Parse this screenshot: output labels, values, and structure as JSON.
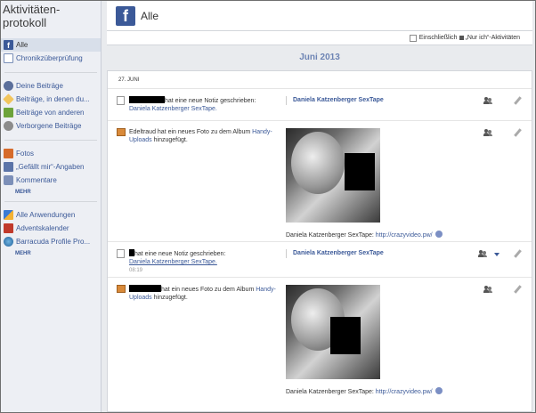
{
  "sidebar": {
    "title": "Aktivitäten-protokoll",
    "group1": [
      {
        "label": "Alle",
        "icon": "facebook-icon",
        "active": true
      },
      {
        "label": "Chronikzüberprüfung",
        "icon": "review-icon"
      }
    ],
    "group2": [
      {
        "label": "Deine Beiträge",
        "icon": "person-icon"
      },
      {
        "label": "Beiträge, in denen du...",
        "icon": "tag-icon"
      },
      {
        "label": "Beiträge von anderen",
        "icon": "post-icon"
      },
      {
        "label": "Verborgene Beiträge",
        "icon": "hidden-icon"
      }
    ],
    "group3": [
      {
        "label": "Fotos",
        "icon": "photos-icon"
      },
      {
        "label": "„Gefällt mir“-Angaben",
        "icon": "like-icon"
      },
      {
        "label": "Kommentare",
        "icon": "comment-icon"
      }
    ],
    "group3_more": "MEHR",
    "group4": [
      {
        "label": "Alle Anwendungen",
        "icon": "apps-icon"
      },
      {
        "label": "Adventskalender",
        "icon": "calendar-icon"
      },
      {
        "label": "Barracuda Profile Pro...",
        "icon": "globe-icon"
      }
    ],
    "group4_more": "MEHR"
  },
  "header": {
    "title": "Alle",
    "logo": "f"
  },
  "filter": {
    "label": "Einschließlich „Nur ich“-Aktivitäten"
  },
  "month": "Juni 2013",
  "day": "27. JUNI",
  "entries": [
    {
      "type": "note",
      "text": "hat eine neue Notiz geschrieben:",
      "link": "Daniela Katzenberger SexTape.",
      "note_title": "Daniela Katzenberger SexTape"
    },
    {
      "type": "photo",
      "text": "Edeltraud hat ein neues Foto zu dem Album",
      "album": "Handy-Uploads",
      "suffix": "hinzugefügt.",
      "caption": "Daniela Katzenberger SexTape: ",
      "url": "http://crazyvideo.pw/"
    },
    {
      "type": "note",
      "text": "hat eine neue Notiz geschrieben:",
      "link": "Daniela Katzenberger SexTape.",
      "time": "08:19",
      "note_title": "Daniela Katzenberger SexTape"
    },
    {
      "type": "photo",
      "text": "hat ein neues Foto zu dem Album",
      "album": "Handy-Uploads",
      "suffix": "hinzugefügt.",
      "caption": "Daniela Katzenberger SexTape: ",
      "url": "http://crazyvideo.pw/"
    }
  ]
}
